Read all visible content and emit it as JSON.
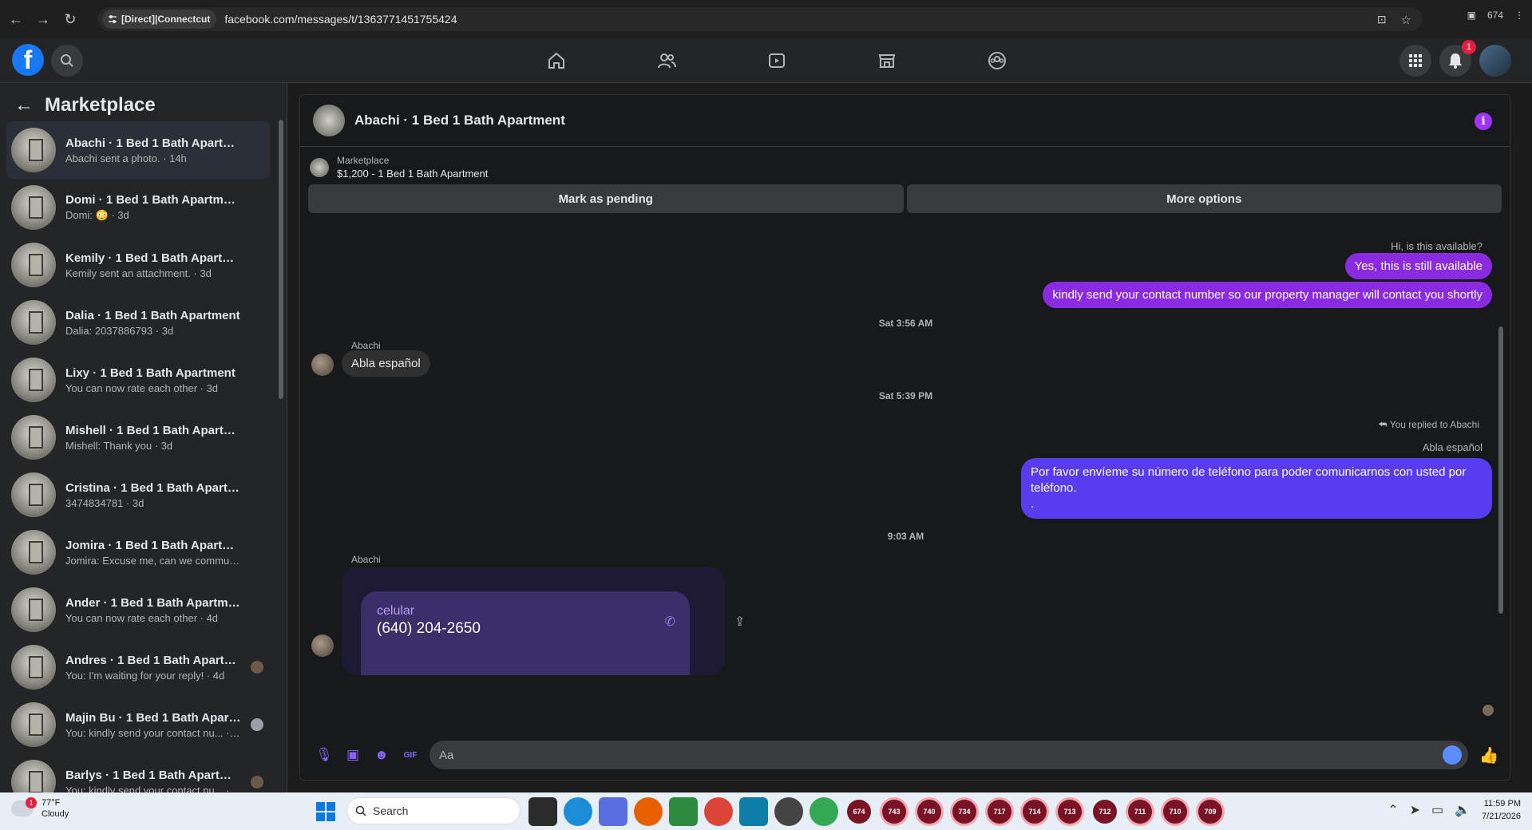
{
  "browser": {
    "site_chip": "[Direct]|Connectcut",
    "url": "facebook.com/messages/t/1363771451755424",
    "tab_count": "674"
  },
  "fb_top": {
    "notifications_count": "1"
  },
  "left_panel": {
    "title": "Marketplace",
    "conversations": [
      {
        "title": "Abachi · 1 Bed 1 Bath Apartment",
        "subtitle": "Abachi sent a photo. · 14h"
      },
      {
        "title": "Domi · 1 Bed 1 Bath Apartment",
        "subtitle": "Domi: 😳 · 3d"
      },
      {
        "title": "Kemily · 1 Bed 1 Bath Apartment",
        "subtitle": "Kemily sent an attachment. · 3d"
      },
      {
        "title": "Dalia · 1 Bed 1 Bath Apartment",
        "subtitle": "Dalia: 2037886793 · 3d"
      },
      {
        "title": "Lixy · 1 Bed 1 Bath Apartment",
        "subtitle": "You can now rate each other · 3d"
      },
      {
        "title": "Mishell · 1 Bed 1 Bath Apartment",
        "subtitle": "Mishell: Thank you · 3d"
      },
      {
        "title": "Cristina · 1 Bed 1 Bath Apartment",
        "subtitle": "3474834781 · 3d"
      },
      {
        "title": "Jomira · 1 Bed 1 Bath Apartment",
        "subtitle": "Jomira: Excuse me, can we commu... · 4d"
      },
      {
        "title": "Ander · 1 Bed 1 Bath Apartment",
        "subtitle": "You can now rate each other · 4d"
      },
      {
        "title": "Andres · 1 Bed 1 Bath Apartme...",
        "subtitle": "You: I'm waiting for your reply! · 4d"
      },
      {
        "title": "Majin Bu · 1 Bed 1 Bath Apart...",
        "subtitle": "You: kindly send your contact nu... · 4d"
      },
      {
        "title": "Barlys · 1 Bed 1 Bath Apartment",
        "subtitle": "You: kindly send your contact nu... · 4d"
      }
    ]
  },
  "chat": {
    "header_name": "Abachi · 1 Bed 1 Bath Apartment",
    "listing_category": "Marketplace",
    "listing_title": "$1,200 - 1 Bed 1 Bath Apartment",
    "mark_pending": "Mark as pending",
    "more_options": "More options",
    "reply_note_1": "You replied to Abachi",
    "quoted_1": "Hi, is this available?",
    "msg_out_1": "Yes, this is still available",
    "msg_out_2": "kindly send your contact number so our property manager will contact you shortly",
    "ts_1": "Sat 3:56 AM",
    "sender_1": "Abachi",
    "msg_in_1": "Abla español",
    "ts_2": "Sat 5:39 PM",
    "reply_note_2": "You replied to Abachi",
    "quoted_2": "Abla español",
    "msg_out_3_line1": "Por favor envíeme su número de teléfono para poder comunicarnos con usted por",
    "msg_out_3_line2": "teléfono.",
    "msg_out_3_line3": ".",
    "ts_3": "9:03 AM",
    "sender_2": "Abachi",
    "photo_label": "celular",
    "photo_number": "(640) 204-2650",
    "composer_placeholder": "Aa"
  },
  "taskbar": {
    "temp": "77°F",
    "condition": "Cloudy",
    "weather_badge": "1",
    "search_label": "Search",
    "app_numbers": [
      "674",
      "743",
      "740",
      "734",
      "717",
      "714",
      "713",
      "712",
      "711",
      "710",
      "709"
    ],
    "time": "11:59 PM",
    "date": "7/21/2026"
  }
}
